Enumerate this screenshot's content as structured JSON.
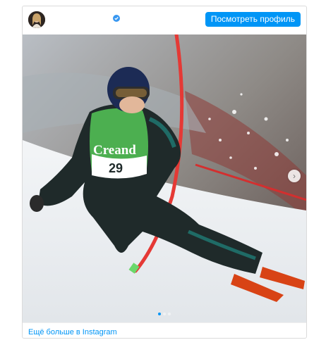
{
  "header": {
    "username": "",
    "profile_button_label": "Посмотреть профиль"
  },
  "media": {
    "bib_number": "29",
    "bib_sponsor": "Creand",
    "carousel": {
      "total": 3,
      "active_index": 0
    }
  },
  "footer": {
    "more_link_label": "Ещё больше в Instagram"
  },
  "colors": {
    "accent": "#0095f6",
    "verified": "#3897f0",
    "gate_pole": "#e53935",
    "bib_green": "#4caf50"
  },
  "icons": {
    "verified": "verified-badge-icon",
    "next": "chevron-right-icon"
  }
}
